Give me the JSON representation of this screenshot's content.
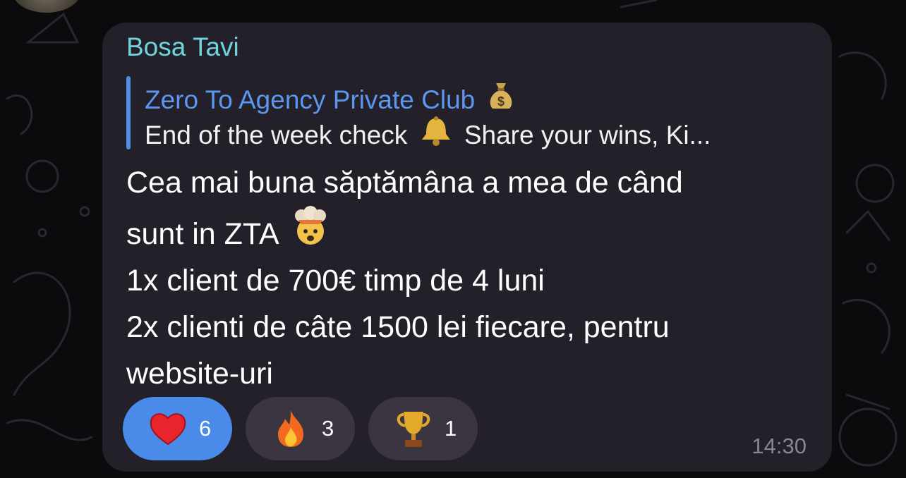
{
  "message": {
    "sender": "Bosa Tavi",
    "reply": {
      "title": "Zero To Agency Private Club",
      "title_emoji": "money-bag-icon",
      "text_before": "End of the week check",
      "text_emoji": "bell-icon",
      "text_after": "Share your wins, Ki..."
    },
    "lines": [
      "Cea mai buna săptămâna a mea de când",
      "sunt in ZTA",
      "1x client de 700€ timp de 4 luni",
      "2x clienti de câte 1500 lei fiecare, pentru",
      "website-uri"
    ],
    "line2_emoji": "exploding-head-icon",
    "time": "14:30"
  },
  "reactions": [
    {
      "emoji": "heart-icon",
      "count": "6",
      "selected": true
    },
    {
      "emoji": "fire-icon",
      "count": "3",
      "selected": false
    },
    {
      "emoji": "trophy-icon",
      "count": "1",
      "selected": false
    }
  ],
  "colors": {
    "bubble": "#24202a",
    "sender": "#6fd5dc",
    "reply_accent": "#5b97ef",
    "reaction_selected": "#4a8bea",
    "reaction_default": "#3a3540",
    "time": "#8a8690"
  }
}
